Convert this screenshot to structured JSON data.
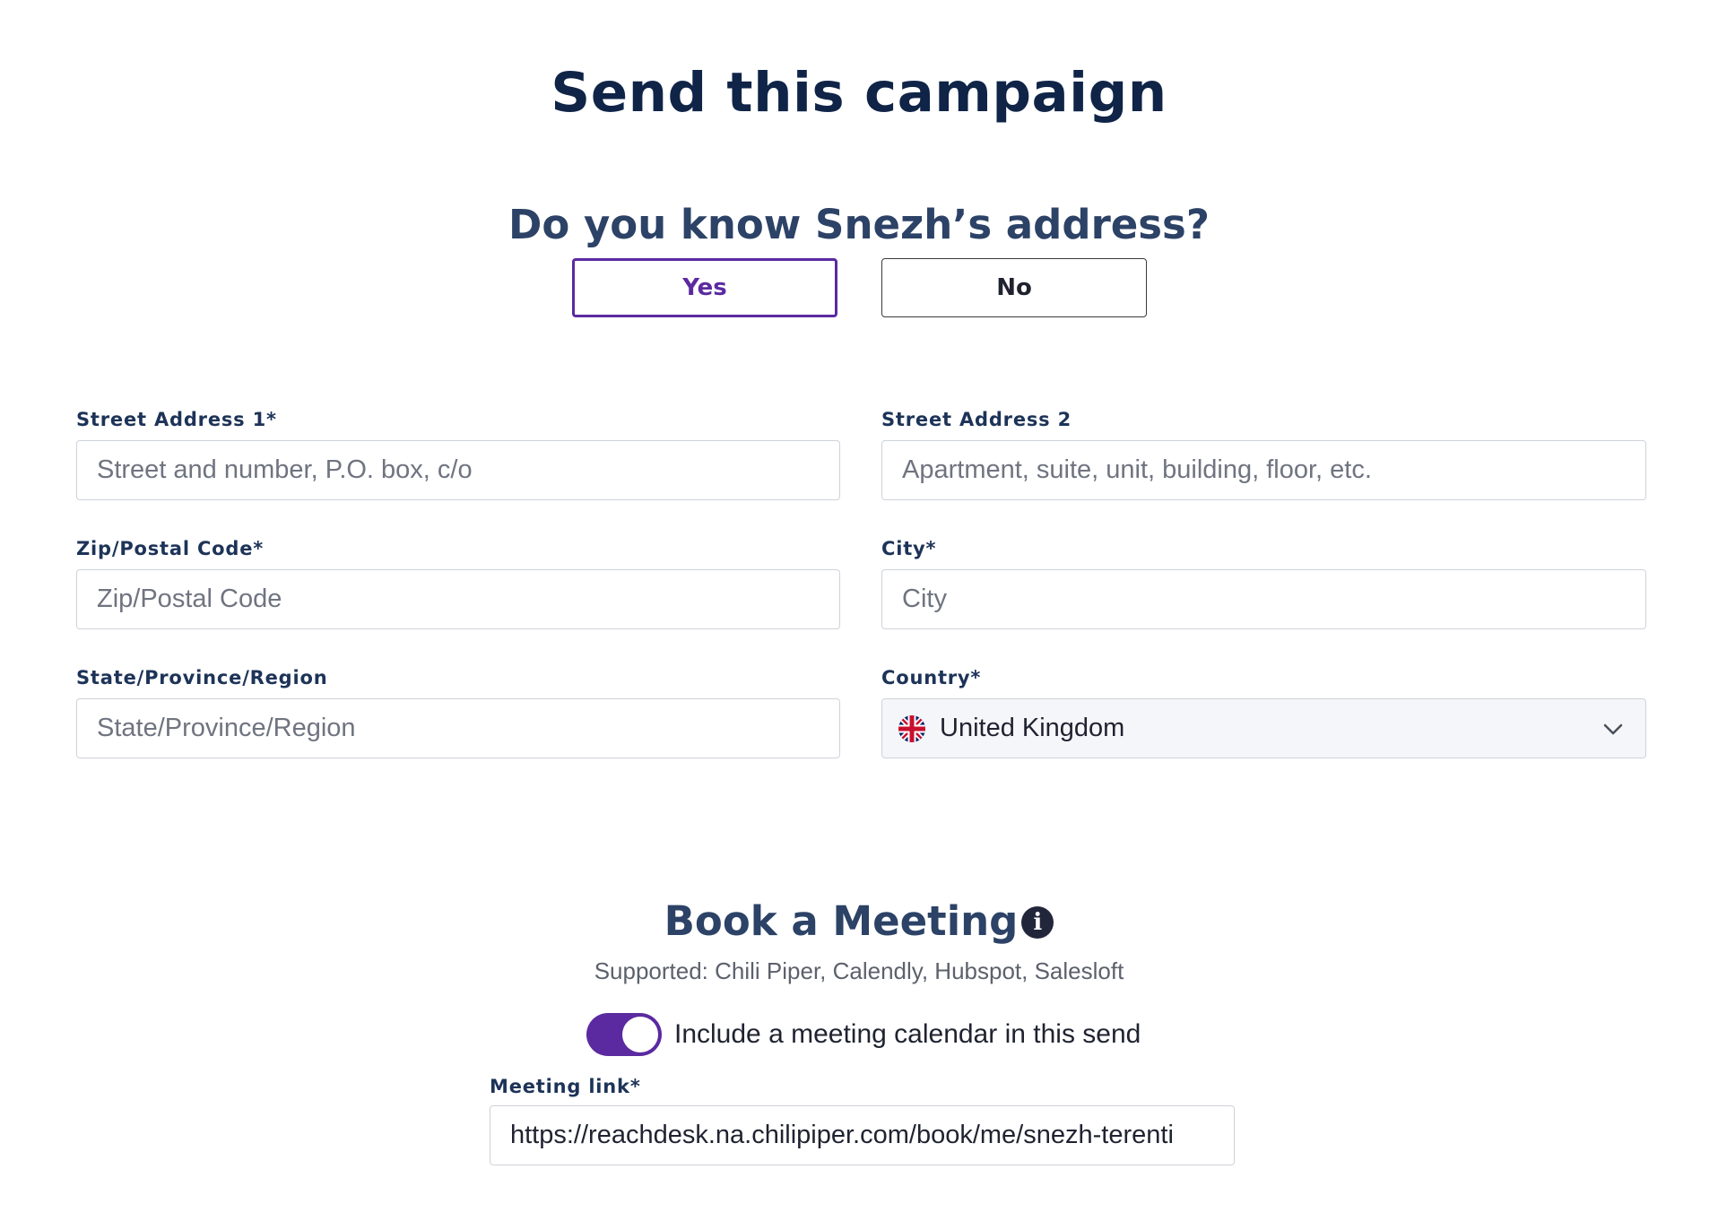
{
  "page": {
    "title": "Send this campaign"
  },
  "address_question": {
    "heading": "Do you know Snezh’s address?",
    "yes_label": "Yes",
    "no_label": "No",
    "selected": "Yes"
  },
  "address_form": {
    "street1": {
      "label": "Street Address 1*",
      "placeholder": "Street and number, P.O. box, c/o",
      "value": ""
    },
    "street2": {
      "label": "Street Address 2",
      "placeholder": "Apartment, suite, unit, building, floor, etc.",
      "value": ""
    },
    "zip": {
      "label": "Zip/Postal Code*",
      "placeholder": "Zip/Postal Code",
      "value": ""
    },
    "city": {
      "label": "City*",
      "placeholder": "City",
      "value": ""
    },
    "state": {
      "label": "State/Province/Region",
      "placeholder": "State/Province/Region",
      "value": ""
    },
    "country": {
      "label": "Country*",
      "value": "United Kingdom",
      "flag_icon": "uk-flag-icon"
    }
  },
  "meeting": {
    "heading": "Book a Meeting",
    "info_icon": "info-icon",
    "supported_text": "Supported: Chili Piper, Calendly, Hubspot, Salesloft",
    "toggle_label": "Include a meeting calendar in this send",
    "toggle_on": true,
    "link_label": "Meeting link*",
    "link_value": "https://reachdesk.na.chilipiper.com/book/me/snezh-terenti"
  },
  "colors": {
    "accent": "#5b2aa0",
    "title": "#0f2447",
    "heading": "#2c4266",
    "label": "#1d3358"
  }
}
